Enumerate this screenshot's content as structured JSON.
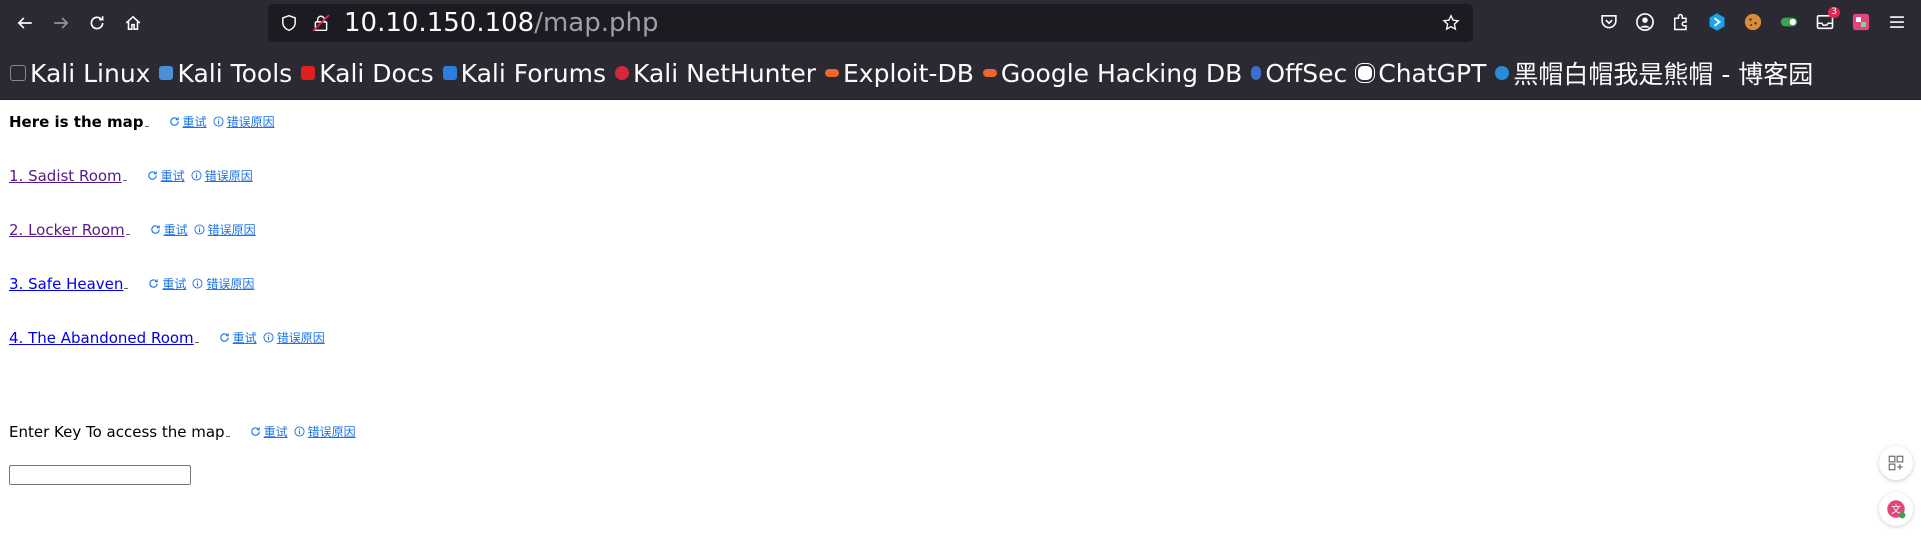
{
  "browser": {
    "url_host": "10.10.150.108",
    "url_path": "/map.php",
    "notification_count": "3",
    "bookmarks": [
      {
        "label": "Kali Linux",
        "color": "#367bf0"
      },
      {
        "label": "Kali Tools",
        "color": "#4a90d9"
      },
      {
        "label": "Kali Docs",
        "color": "#e02020"
      },
      {
        "label": "Kali Forums",
        "color": "#2f7de1"
      },
      {
        "label": "Kali NetHunter",
        "color": "#d7263d"
      },
      {
        "label": "Exploit-DB",
        "color": "#f0642d"
      },
      {
        "label": "Google Hacking DB",
        "color": "#f0642d"
      },
      {
        "label": "OffSec",
        "color": "#3b6fd1"
      },
      {
        "label": "ChatGPT",
        "color": "#ffffff"
      },
      {
        "label": "黑帽白帽我是熊帽 - 博客园",
        "color": "#2a8bd8"
      }
    ]
  },
  "page": {
    "heading": "Here is the map",
    "rooms": [
      {
        "label": "1. Sadist Room",
        "visited": true
      },
      {
        "label": "2. Locker Room",
        "visited": true
      },
      {
        "label": "3. Safe Heaven",
        "visited": false
      },
      {
        "label": "4. The Abandoned Room",
        "visited": false
      }
    ],
    "key_prompt": "Enter Key To access the map",
    "key_value": ""
  },
  "translate_ext": {
    "retry_label": "重试",
    "reason_label": "错误原因"
  }
}
